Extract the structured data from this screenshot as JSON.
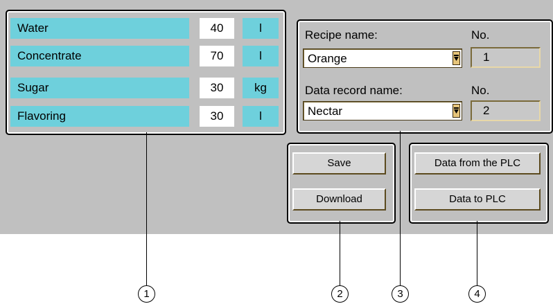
{
  "ingredients": [
    {
      "name": "Water",
      "value": "40",
      "unit": "l"
    },
    {
      "name": "Concentrate",
      "value": "70",
      "unit": "l"
    },
    {
      "name": "Sugar",
      "value": "30",
      "unit": "kg"
    },
    {
      "name": "Flavoring",
      "value": "30",
      "unit": "l"
    }
  ],
  "recipe": {
    "name_label": "Recipe name:",
    "no_label": "No.",
    "selected": "Orange",
    "number": "1"
  },
  "record": {
    "name_label": "Data record name:",
    "no_label": "No.",
    "selected": "Nectar",
    "number": "2"
  },
  "buttons": {
    "save": "Save",
    "download": "Download",
    "data_from_plc": "Data from the PLC",
    "data_to_plc": "Data to PLC"
  },
  "callouts": [
    "1",
    "2",
    "3",
    "4"
  ],
  "colors": {
    "cell": "#6ed0dc",
    "panel": "#c0c0c0",
    "dropdown_button": "#e6c47a"
  }
}
